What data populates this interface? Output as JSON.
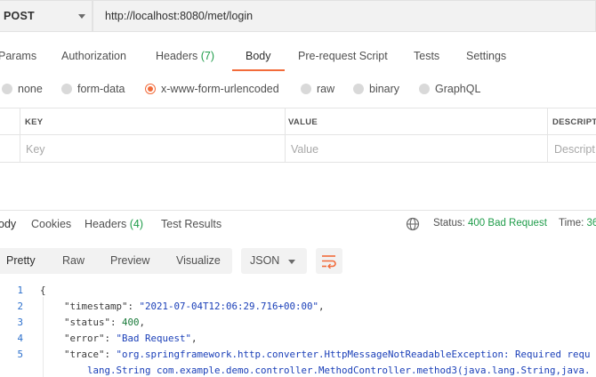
{
  "request": {
    "method": "POST",
    "url": "http://localhost:8080/met/login"
  },
  "request_tabs": {
    "params": "Params",
    "authorization": "Authorization",
    "headers": "Headers",
    "headers_count": "(7)",
    "body": "Body",
    "pre_request": "Pre-request Script",
    "tests": "Tests",
    "settings": "Settings"
  },
  "body_types": {
    "none": "none",
    "form_data": "form-data",
    "urlencoded": "x-www-form-urlencoded",
    "raw": "raw",
    "binary": "binary",
    "graphql": "GraphQL",
    "selected": "x-www-form-urlencoded"
  },
  "kv_table": {
    "headers": {
      "key": "KEY",
      "value": "VALUE",
      "description": "DESCRIPTI"
    },
    "placeholders": {
      "key": "Key",
      "value": "Value",
      "description": "Descript"
    }
  },
  "response_tabs": {
    "body": "ody",
    "cookies": "Cookies",
    "headers": "Headers",
    "headers_count": "(4)",
    "test_results": "Test Results"
  },
  "response_status": {
    "status_label": "Status:",
    "status_value": "400 Bad Request",
    "time_label": "Time:",
    "time_value": "36"
  },
  "view_modes": {
    "pretty": "Pretty",
    "raw": "Raw",
    "preview": "Preview",
    "visualize": "Visualize",
    "format": "JSON"
  },
  "code": {
    "line_numbers": [
      "1",
      "2",
      "3",
      "4",
      "5"
    ],
    "open_brace": "{",
    "timestamp_key": "\"timestamp\"",
    "timestamp_value": "\"2021-07-04T12:06:29.716+00:00\"",
    "status_key": "\"status\"",
    "status_value": "400",
    "error_key": "\"error\"",
    "error_value": "\"Bad Request\"",
    "trace_key": "\"trace\"",
    "trace_value": "\"org.springframework.http.converter.HttpMessageNotReadableException: Required requ",
    "trace_continued": "lang.String com.example.demo.controller.MethodController.method3(java.lang.String,java."
  },
  "colors": {
    "accent": "#f26b3a",
    "success": "#1f9c4a",
    "json_string": "#1a3fb8",
    "json_number": "#1a7a3a"
  }
}
